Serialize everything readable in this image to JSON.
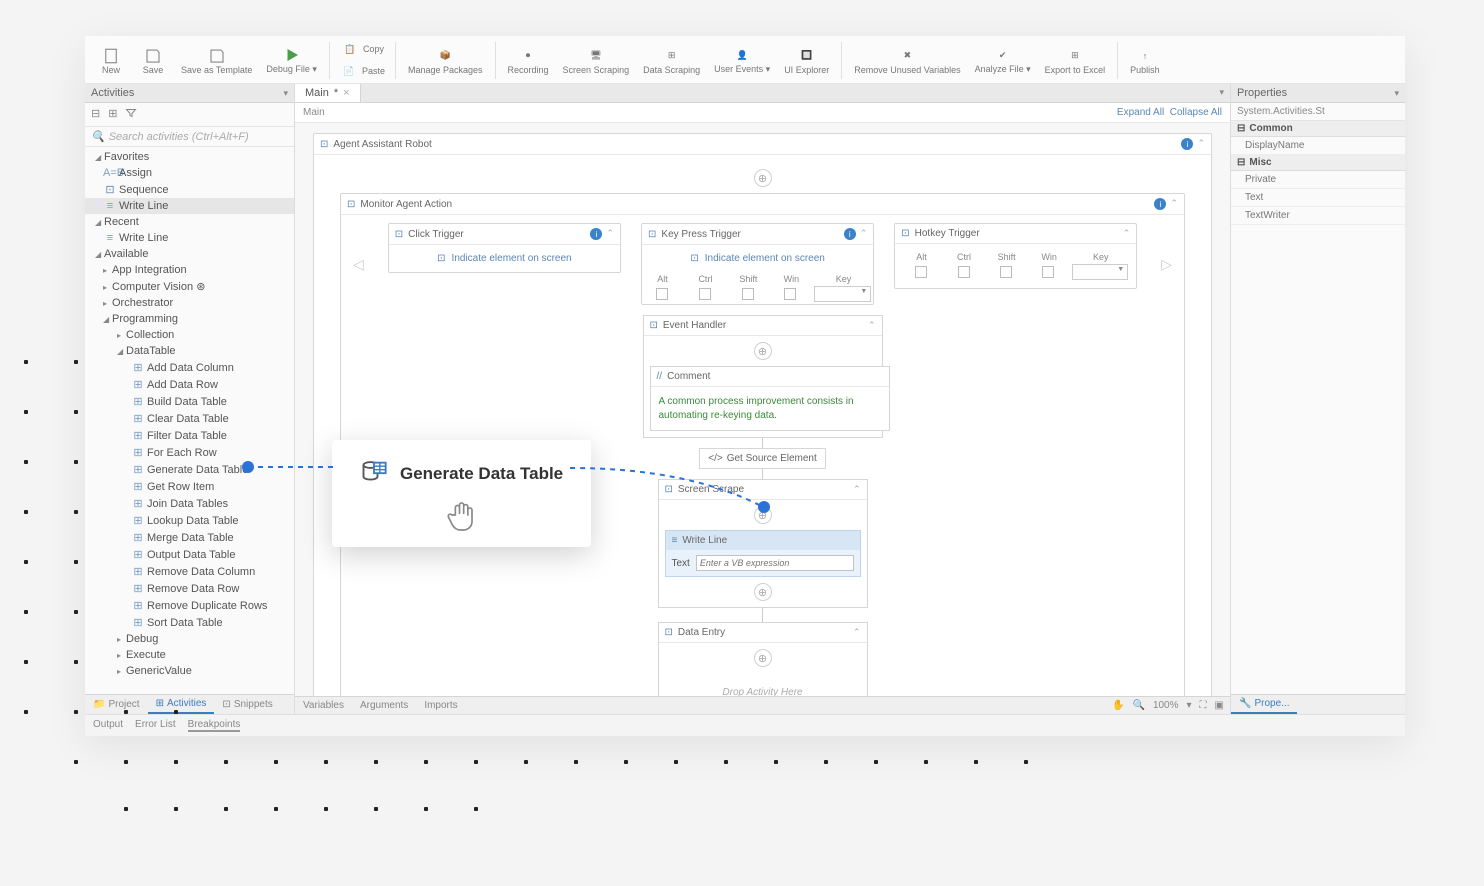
{
  "ribbon": {
    "new": "New",
    "save": "Save",
    "save_as": "Save as Template",
    "debug": "Debug File ▾",
    "copy": "Copy",
    "paste": "Paste",
    "manage_pkg": "Manage Packages",
    "recording": "Recording",
    "screen_scrape": "Screen Scraping",
    "data_scrape": "Data Scraping",
    "user_events": "User Events ▾",
    "ui_explorer": "UI Explorer",
    "remove_unused": "Remove Unused Variables",
    "analyze": "Analyze File ▾",
    "export_excel": "Export to Excel",
    "publish": "Publish"
  },
  "activities": {
    "title": "Activities",
    "search_ph": "Search activities (Ctrl+Alt+F)",
    "fav": "Favorites",
    "fav_items": [
      "Assign",
      "Sequence",
      "Write Line"
    ],
    "recent": "Recent",
    "recent_items": [
      "Write Line"
    ],
    "available": "Available",
    "groups": {
      "app": "App Integration",
      "cv": "Computer Vision",
      "orch": "Orchestrator",
      "prog": "Programming",
      "collection": "Collection",
      "datatable": "DataTable",
      "debug": "Debug",
      "execute": "Execute",
      "generic": "GenericValue"
    },
    "dt": [
      "Add Data Column",
      "Add Data Row",
      "Build Data Table",
      "Clear Data Table",
      "Filter Data Table",
      "For Each Row",
      "Generate Data Table",
      "Get Row Item",
      "Join Data Tables",
      "Lookup Data Table",
      "Merge Data Table",
      "Output Data Table",
      "Remove Data Column",
      "Remove Data Row",
      "Remove Duplicate Rows",
      "Sort Data Table"
    ]
  },
  "bottom_left": {
    "project": "Project",
    "activities": "Activities",
    "snippets": "Snippets"
  },
  "output": {
    "output": "Output",
    "errors": "Error List",
    "breakpoints": "Breakpoints"
  },
  "tab": {
    "main": "Main"
  },
  "crumb": {
    "main": "Main",
    "expand": "Expand All",
    "collapse": "Collapse All"
  },
  "flow": {
    "root": "Agent Assistant Robot",
    "monitor": "Monitor Agent Action",
    "click_trigger": "Click Trigger",
    "indicate": "Indicate element on screen",
    "key_trigger": "Key Press Trigger",
    "hotkey_trigger": "Hotkey Trigger",
    "keys": {
      "alt": "Alt",
      "ctrl": "Ctrl",
      "shift": "Shift",
      "win": "Win",
      "key": "Key"
    },
    "event_handler": "Event Handler",
    "comment_h": "Comment",
    "comment": "A common process improvement consists in automating re-keying data.",
    "get_source": "Get Source Element",
    "screen_scrape": "Screen Scrape",
    "write_line": "Write Line",
    "text_label": "Text",
    "vb_ph": "Enter a VB expression",
    "data_entry": "Data Entry",
    "drop": "Drop Activity Here"
  },
  "vars": {
    "variables": "Variables",
    "arguments": "Arguments",
    "imports": "Imports"
  },
  "zoom": "100%",
  "props": {
    "title": "Properties",
    "type": "System.Activities.St",
    "common": "Common",
    "display": "DisplayName",
    "misc": "Misc",
    "private": "Private",
    "text": "Text",
    "textwriter": "TextWriter",
    "proplink": "Prope..."
  },
  "highlight": "Generate Data Table"
}
